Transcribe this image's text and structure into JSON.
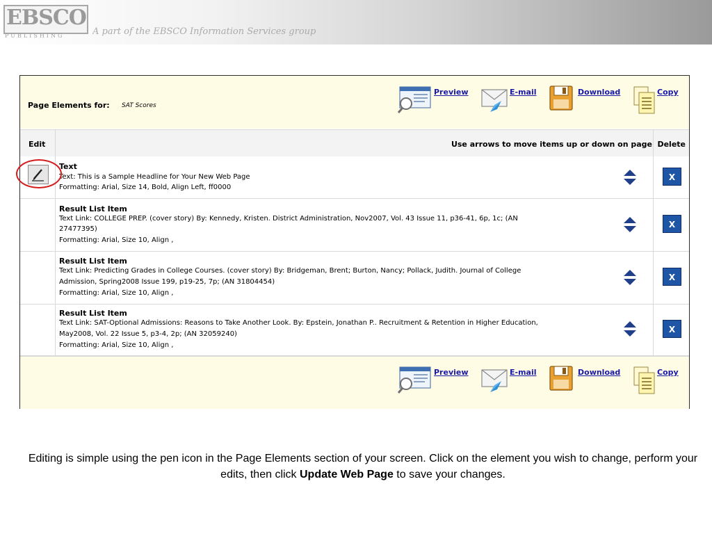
{
  "banner": {
    "logo_text": "EBSCO",
    "logo_sub": "PUBLISHING",
    "tagline": "A part of the EBSCO Information Services group"
  },
  "panel": {
    "page_elements_label": "Page Elements for:",
    "page_elements_value": "SAT Scores",
    "actions": [
      {
        "label": "Preview",
        "icon": "preview-icon"
      },
      {
        "label": "E-mail",
        "icon": "email-icon"
      },
      {
        "label": "Download",
        "icon": "download-icon"
      },
      {
        "label": "Copy",
        "icon": "copy-icon"
      }
    ],
    "headers": {
      "edit": "Edit",
      "move": "Use arrows to move items up or down on page",
      "delete": "Delete"
    },
    "rows": [
      {
        "title": "Text",
        "lines": [
          "Text: This is a Sample Headline for Your New Web Page",
          "Formatting: Arial, Size 14, Bold, Align Left, ff0000"
        ]
      },
      {
        "title": "Result List Item",
        "lines": [
          "Text Link: COLLEGE PREP. (cover story) By: Kennedy, Kristen. District Administration, Nov2007, Vol. 43 Issue 11, p36-41, 6p, 1c; (AN",
          "27477395)",
          "Formatting: Arial, Size 10, Align ,"
        ]
      },
      {
        "title": "Result List Item",
        "lines": [
          "Text Link: Predicting Grades in College Courses. (cover story) By: Bridgeman, Brent; Burton, Nancy; Pollack, Judith. Journal of College",
          "Admission, Spring2008 Issue 199, p19-25, 7p; (AN 31804454)",
          "Formatting: Arial, Size 10, Align ,"
        ]
      },
      {
        "title": "Result List Item",
        "lines": [
          "Text Link: SAT-Optional Admissions: Reasons to Take Another Look. By: Epstein, Jonathan P.. Recruitment & Retention in Higher Education,",
          "May2008, Vol. 22 Issue 5, p3-4, 2p; (AN 32059240)",
          "Formatting: Arial, Size 10, Align ,"
        ]
      }
    ],
    "delete_label": "X"
  },
  "caption": {
    "part1": "Editing is simple using the pen icon in the Page Elements section of your screen. Click on the element you wish to change, perform your edits, then click ",
    "bold": "Update Web Page",
    "part2": " to save your changes."
  },
  "colors": {
    "link": "#1a1aa8",
    "delete_button": "#1f55a5",
    "panel_bg": "#fffce6",
    "highlight_ring": "#d51b1b"
  }
}
